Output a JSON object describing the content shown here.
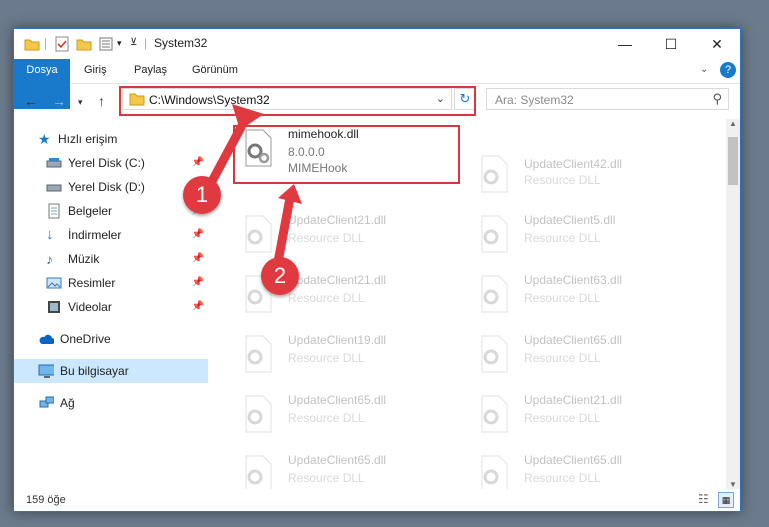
{
  "window": {
    "title": "System32"
  },
  "ribbon": {
    "tabs": [
      "Dosya",
      "Giriş",
      "Paylaş",
      "Görünüm"
    ]
  },
  "address": {
    "path": "C:\\Windows\\System32"
  },
  "search": {
    "placeholder": "Ara: System32"
  },
  "sidebar": {
    "items": [
      {
        "label": "Hızlı erişim",
        "icon": "star-icon",
        "pinned": false
      },
      {
        "label": "Yerel Disk (C:)",
        "icon": "drive-icon",
        "pinned": true
      },
      {
        "label": "Yerel Disk (D:)",
        "icon": "drive-icon",
        "pinned": true
      },
      {
        "label": "Belgeler",
        "icon": "documents-icon",
        "pinned": true
      },
      {
        "label": "İndirmeler",
        "icon": "download-icon",
        "pinned": true
      },
      {
        "label": "Müzik",
        "icon": "music-icon",
        "pinned": true
      },
      {
        "label": "Resimler",
        "icon": "pictures-icon",
        "pinned": true
      },
      {
        "label": "Videolar",
        "icon": "video-icon",
        "pinned": true
      },
      {
        "label": "OneDrive",
        "icon": "cloud-icon",
        "pinned": false
      },
      {
        "label": "Bu bilgisayar",
        "icon": "computer-icon",
        "pinned": false
      },
      {
        "label": "Ağ",
        "icon": "network-icon",
        "pinned": false
      }
    ]
  },
  "files": {
    "featured": {
      "name": "mimehook.dll",
      "version": "8.0.0.0",
      "description": "MIMEHook"
    },
    "left": [
      {
        "name": "UpdateClient21.dll",
        "type": "Resource DLL"
      },
      {
        "name": "UpdateClient21.dll",
        "type": "Resource DLL"
      },
      {
        "name": "UpdateClient19.dll",
        "type": "Resource DLL"
      },
      {
        "name": "UpdateClient65.dll",
        "type": "Resource DLL"
      },
      {
        "name": "UpdateClient65.dll",
        "type": "Resource DLL"
      }
    ],
    "right": [
      {
        "name": "UpdateClient42.dll",
        "type": "Resource DLL"
      },
      {
        "name": "UpdateClient5.dll",
        "type": "Resource DLL"
      },
      {
        "name": "UpdateClient63.dll",
        "type": "Resource DLL"
      },
      {
        "name": "UpdateClient65.dll",
        "type": "Resource DLL"
      },
      {
        "name": "UpdateClient21.dll",
        "type": "Resource DLL"
      },
      {
        "name": "UpdateClient65.dll",
        "type": "Resource DLL"
      }
    ]
  },
  "status": {
    "count": "159 öğe"
  },
  "annotations": {
    "step1": "1",
    "step2": "2"
  },
  "colors": {
    "accent": "#1979ca",
    "highlight": "#d9363e",
    "selected": "#cce8ff"
  }
}
